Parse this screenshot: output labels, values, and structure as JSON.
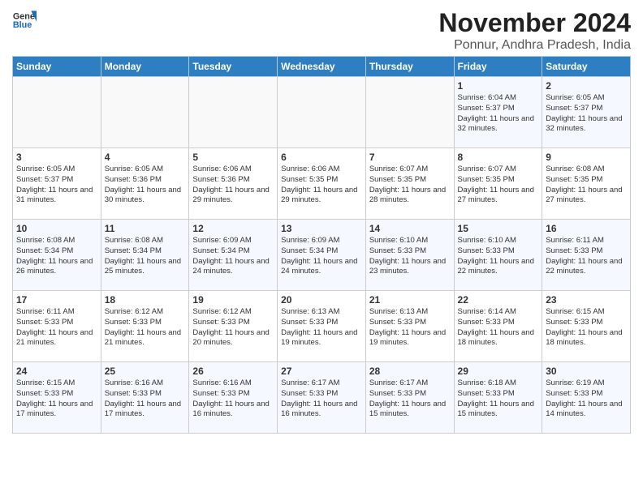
{
  "logo": {
    "line1": "General",
    "line2": "Blue"
  },
  "title": "November 2024",
  "subtitle": "Ponnur, Andhra Pradesh, India",
  "headers": [
    "Sunday",
    "Monday",
    "Tuesday",
    "Wednesday",
    "Thursday",
    "Friday",
    "Saturday"
  ],
  "weeks": [
    [
      {
        "day": "",
        "info": ""
      },
      {
        "day": "",
        "info": ""
      },
      {
        "day": "",
        "info": ""
      },
      {
        "day": "",
        "info": ""
      },
      {
        "day": "",
        "info": ""
      },
      {
        "day": "1",
        "info": "Sunrise: 6:04 AM\nSunset: 5:37 PM\nDaylight: 11 hours and 32 minutes."
      },
      {
        "day": "2",
        "info": "Sunrise: 6:05 AM\nSunset: 5:37 PM\nDaylight: 11 hours and 32 minutes."
      }
    ],
    [
      {
        "day": "3",
        "info": "Sunrise: 6:05 AM\nSunset: 5:37 PM\nDaylight: 11 hours and 31 minutes."
      },
      {
        "day": "4",
        "info": "Sunrise: 6:05 AM\nSunset: 5:36 PM\nDaylight: 11 hours and 30 minutes."
      },
      {
        "day": "5",
        "info": "Sunrise: 6:06 AM\nSunset: 5:36 PM\nDaylight: 11 hours and 29 minutes."
      },
      {
        "day": "6",
        "info": "Sunrise: 6:06 AM\nSunset: 5:35 PM\nDaylight: 11 hours and 29 minutes."
      },
      {
        "day": "7",
        "info": "Sunrise: 6:07 AM\nSunset: 5:35 PM\nDaylight: 11 hours and 28 minutes."
      },
      {
        "day": "8",
        "info": "Sunrise: 6:07 AM\nSunset: 5:35 PM\nDaylight: 11 hours and 27 minutes."
      },
      {
        "day": "9",
        "info": "Sunrise: 6:08 AM\nSunset: 5:35 PM\nDaylight: 11 hours and 27 minutes."
      }
    ],
    [
      {
        "day": "10",
        "info": "Sunrise: 6:08 AM\nSunset: 5:34 PM\nDaylight: 11 hours and 26 minutes."
      },
      {
        "day": "11",
        "info": "Sunrise: 6:08 AM\nSunset: 5:34 PM\nDaylight: 11 hours and 25 minutes."
      },
      {
        "day": "12",
        "info": "Sunrise: 6:09 AM\nSunset: 5:34 PM\nDaylight: 11 hours and 24 minutes."
      },
      {
        "day": "13",
        "info": "Sunrise: 6:09 AM\nSunset: 5:34 PM\nDaylight: 11 hours and 24 minutes."
      },
      {
        "day": "14",
        "info": "Sunrise: 6:10 AM\nSunset: 5:33 PM\nDaylight: 11 hours and 23 minutes."
      },
      {
        "day": "15",
        "info": "Sunrise: 6:10 AM\nSunset: 5:33 PM\nDaylight: 11 hours and 22 minutes."
      },
      {
        "day": "16",
        "info": "Sunrise: 6:11 AM\nSunset: 5:33 PM\nDaylight: 11 hours and 22 minutes."
      }
    ],
    [
      {
        "day": "17",
        "info": "Sunrise: 6:11 AM\nSunset: 5:33 PM\nDaylight: 11 hours and 21 minutes."
      },
      {
        "day": "18",
        "info": "Sunrise: 6:12 AM\nSunset: 5:33 PM\nDaylight: 11 hours and 21 minutes."
      },
      {
        "day": "19",
        "info": "Sunrise: 6:12 AM\nSunset: 5:33 PM\nDaylight: 11 hours and 20 minutes."
      },
      {
        "day": "20",
        "info": "Sunrise: 6:13 AM\nSunset: 5:33 PM\nDaylight: 11 hours and 19 minutes."
      },
      {
        "day": "21",
        "info": "Sunrise: 6:13 AM\nSunset: 5:33 PM\nDaylight: 11 hours and 19 minutes."
      },
      {
        "day": "22",
        "info": "Sunrise: 6:14 AM\nSunset: 5:33 PM\nDaylight: 11 hours and 18 minutes."
      },
      {
        "day": "23",
        "info": "Sunrise: 6:15 AM\nSunset: 5:33 PM\nDaylight: 11 hours and 18 minutes."
      }
    ],
    [
      {
        "day": "24",
        "info": "Sunrise: 6:15 AM\nSunset: 5:33 PM\nDaylight: 11 hours and 17 minutes."
      },
      {
        "day": "25",
        "info": "Sunrise: 6:16 AM\nSunset: 5:33 PM\nDaylight: 11 hours and 17 minutes."
      },
      {
        "day": "26",
        "info": "Sunrise: 6:16 AM\nSunset: 5:33 PM\nDaylight: 11 hours and 16 minutes."
      },
      {
        "day": "27",
        "info": "Sunrise: 6:17 AM\nSunset: 5:33 PM\nDaylight: 11 hours and 16 minutes."
      },
      {
        "day": "28",
        "info": "Sunrise: 6:17 AM\nSunset: 5:33 PM\nDaylight: 11 hours and 15 minutes."
      },
      {
        "day": "29",
        "info": "Sunrise: 6:18 AM\nSunset: 5:33 PM\nDaylight: 11 hours and 15 minutes."
      },
      {
        "day": "30",
        "info": "Sunrise: 6:19 AM\nSunset: 5:33 PM\nDaylight: 11 hours and 14 minutes."
      }
    ]
  ]
}
